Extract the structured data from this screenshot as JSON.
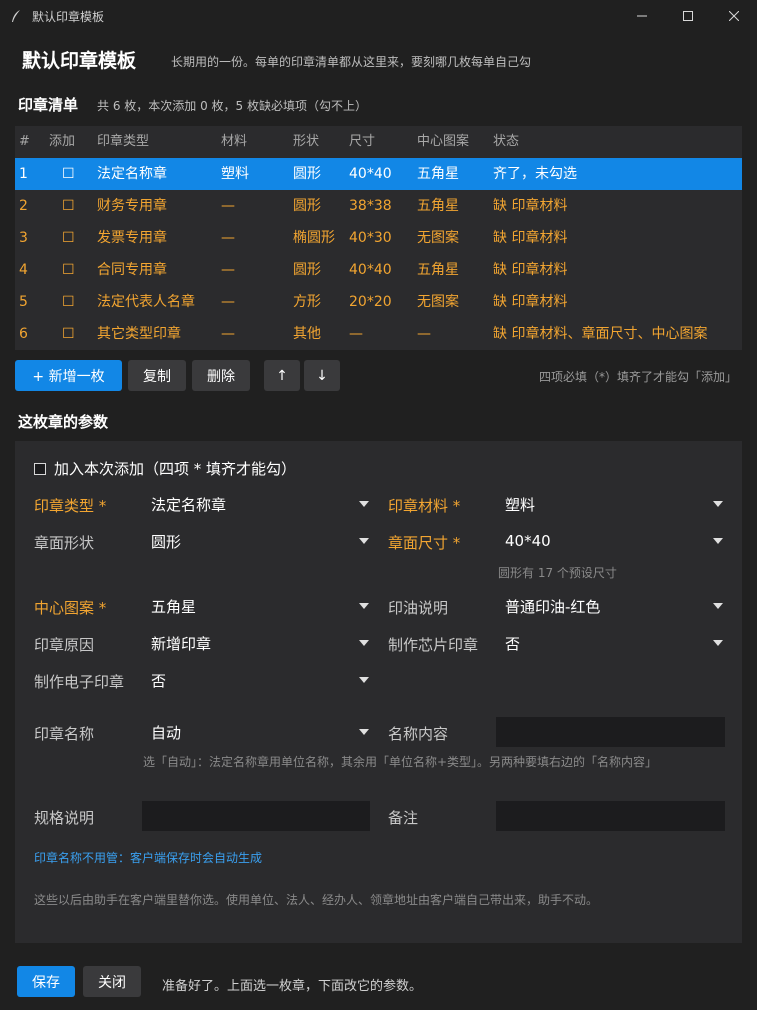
{
  "window": {
    "title": "默认印章模板",
    "controls": [
      "minimize",
      "maximize",
      "close"
    ]
  },
  "header": {
    "title": "默认印章模板",
    "subtitle": "长期用的一份。每单的印章清单都从这里来，要刻哪几枚每单自己勾"
  },
  "list_section": {
    "title": "印章清单",
    "summary": "共 6 枚，本次添加 0 枚，5 枚缺必填项（勾不上）"
  },
  "table": {
    "columns": [
      "#",
      "添加",
      "印章类型",
      "材料",
      "形状",
      "尺寸",
      "中心图案",
      "状态"
    ],
    "rows": [
      {
        "num": "1",
        "check": "☐",
        "type": "法定名称章",
        "material": "塑料",
        "shape": "圆形",
        "size": "40*40",
        "pattern": "五角星",
        "status": "齐了，未勾选",
        "selected": true
      },
      {
        "num": "2",
        "check": "☐",
        "type": "财务专用章",
        "material": "—",
        "shape": "圆形",
        "size": "38*38",
        "pattern": "五角星",
        "status": "缺 印章材料"
      },
      {
        "num": "3",
        "check": "☐",
        "type": "发票专用章",
        "material": "—",
        "shape": "椭圆形",
        "size": "40*30",
        "pattern": "无图案",
        "status": "缺 印章材料"
      },
      {
        "num": "4",
        "check": "☐",
        "type": "合同专用章",
        "material": "—",
        "shape": "圆形",
        "size": "40*40",
        "pattern": "五角星",
        "status": "缺 印章材料"
      },
      {
        "num": "5",
        "check": "☐",
        "type": "法定代表人名章",
        "material": "—",
        "shape": "方形",
        "size": "20*20",
        "pattern": "无图案",
        "status": "缺 印章材料"
      },
      {
        "num": "6",
        "check": "☐",
        "type": "其它类型印章",
        "material": "—",
        "shape": "其他",
        "size": "—",
        "pattern": "—",
        "status": "缺 印章材料、章面尺寸、中心图案"
      }
    ]
  },
  "toolbar": {
    "add": "+ 新增一枚",
    "copy": "复制",
    "delete": "删除",
    "up": "↑",
    "down": "↓",
    "hint": "四项必填（*）填齐了才能勾「添加」"
  },
  "params_section": {
    "title": "这枚章的参数"
  },
  "form": {
    "add_checkbox": "加入本次添加（四项 * 填齐才能勾）",
    "seal_type": {
      "label": "印章类型 *",
      "value": "法定名称章"
    },
    "seal_material": {
      "label": "印章材料 *",
      "value": "塑料"
    },
    "face_shape": {
      "label": "章面形状",
      "value": "圆形"
    },
    "face_size": {
      "label": "章面尺寸 *",
      "value": "40*40"
    },
    "size_hint": "圆形有 17 个预设尺寸",
    "center_pattern": {
      "label": "中心图案 *",
      "value": "五角星"
    },
    "ink": {
      "label": "印油说明",
      "value": "普通印油-红色"
    },
    "reason": {
      "label": "印章原因",
      "value": "新增印章"
    },
    "chip": {
      "label": "制作芯片印章",
      "value": "否"
    },
    "e_seal": {
      "label": "制作电子印章",
      "value": "否"
    },
    "seal_name": {
      "label": "印章名称",
      "value": "自动"
    },
    "name_content": {
      "label": "名称内容",
      "value": ""
    },
    "name_note": "选「自动」：法定名称章用单位名称，其余用「单位名称+类型」。另两种要填右边的「名称内容」",
    "spec": {
      "label": "规格说明",
      "value": ""
    },
    "remark": {
      "label": "备注",
      "value": ""
    },
    "auto_link": "印章名称不用管：客户端保存时会自动生成",
    "bottom_note": "这些以后由助手在客户端里替你选。使用单位、法人、经办人、领章地址由客户端自己带出来，助手不动。"
  },
  "footer": {
    "save": "保存",
    "close": "关闭",
    "status": "准备好了。上面选一枚章，下面改它的参数。"
  },
  "colors": {
    "accent": "#1287e6",
    "warning": "#f2a531",
    "bg": "#202020",
    "panel": "#2b2b2d"
  }
}
